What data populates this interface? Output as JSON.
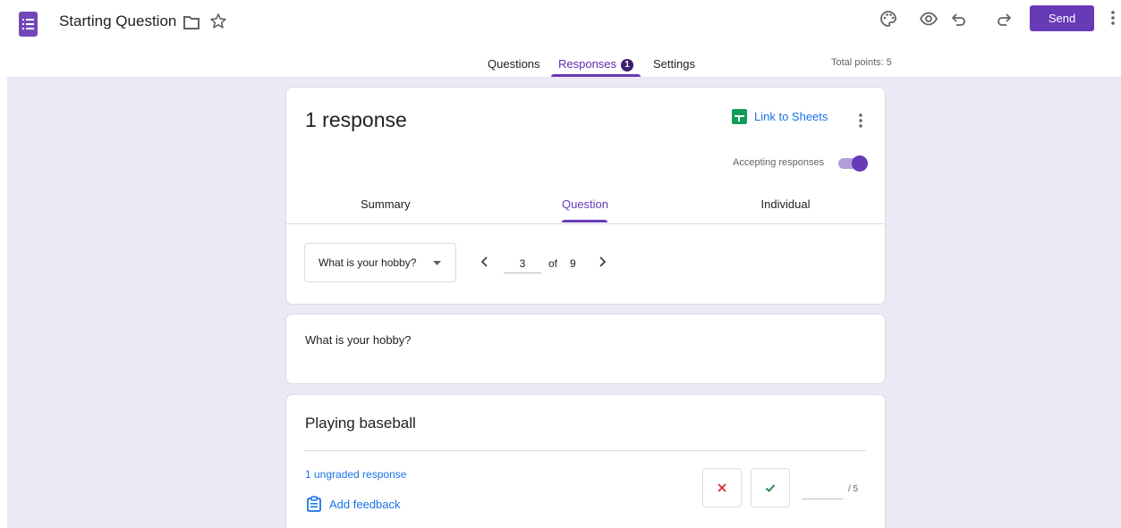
{
  "header": {
    "title": "Starting Question",
    "send_label": "Send",
    "icons": [
      "forms-app-icon",
      "folder-icon",
      "star-icon",
      "palette-icon",
      "preview-eye-icon",
      "undo-icon",
      "redo-icon",
      "more-vert-icon"
    ]
  },
  "nav": {
    "tabs": [
      {
        "label": "Questions",
        "active": false
      },
      {
        "label": "Responses",
        "active": true,
        "badge": "1"
      },
      {
        "label": "Settings",
        "active": false
      }
    ],
    "total_points": "Total points: 5"
  },
  "summary_card": {
    "response_count": "1 response",
    "sheets_label": "Link to Sheets",
    "accepting_label": "Accepting responses",
    "accepting_on": true,
    "tabs": [
      {
        "label": "Summary",
        "active": false
      },
      {
        "label": "Question",
        "active": true
      },
      {
        "label": "Individual",
        "active": false
      }
    ],
    "question_select": "What is your hobby?",
    "pager": {
      "current": "3",
      "of_label": "of",
      "total": "9"
    }
  },
  "question_card": {
    "text": "What is your hobby?"
  },
  "answer_card": {
    "answer": "Playing baseball",
    "ungraded_label": "1 ungraded response",
    "feedback_label": "Add feedback",
    "points_value": "",
    "points_max": "/ 5"
  },
  "colors": {
    "accent": "#673ab7",
    "link": "#1a73e8",
    "canvas": "#ece8f6",
    "sheets_green": "#0f9d58",
    "incorrect": "#d93025",
    "correct": "#188038"
  }
}
